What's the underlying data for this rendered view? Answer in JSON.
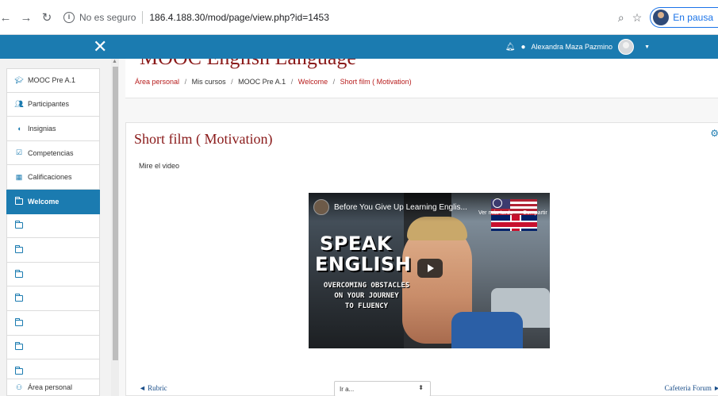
{
  "browser": {
    "back_icon": "arrow-left",
    "forward_icon": "arrow-right",
    "reload_icon": "reload",
    "security_text": "No es seguro",
    "url": "186.4.188.30/mod/page/view.php?id=1453",
    "profile_label": "En pausa"
  },
  "topbar": {
    "close_icon": "✕",
    "user_name": "Alexandra Maza Pazmino",
    "accent_color": "#1b7bb0"
  },
  "sidebar": {
    "items": [
      {
        "icon": "graduation-cap",
        "label": "MOOC Pre A.1",
        "active": false
      },
      {
        "icon": "users",
        "label": "Participantes",
        "active": false
      },
      {
        "icon": "shield",
        "label": "Insignias",
        "active": false
      },
      {
        "icon": "checkbox",
        "label": "Competencias",
        "active": false
      },
      {
        "icon": "table",
        "label": "Calificaciones",
        "active": false
      },
      {
        "icon": "folder",
        "label": "Welcome",
        "active": true
      },
      {
        "icon": "folder",
        "label": "",
        "active": false
      },
      {
        "icon": "folder",
        "label": "",
        "active": false
      },
      {
        "icon": "folder",
        "label": "",
        "active": false
      },
      {
        "icon": "folder",
        "label": "",
        "active": false
      },
      {
        "icon": "folder",
        "label": "",
        "active": false
      },
      {
        "icon": "folder",
        "label": "",
        "active": false
      },
      {
        "icon": "folder",
        "label": "",
        "active": false
      }
    ],
    "bottom_item": {
      "icon": "dashboard",
      "label": "Área personal"
    }
  },
  "header": {
    "course_title": "MOOC English Language",
    "breadcrumb": [
      {
        "label": "Área personal",
        "link": true
      },
      {
        "label": "Mis cursos",
        "link": false
      },
      {
        "label": "MOOC Pre A.1",
        "link": false
      },
      {
        "label": "Welcome",
        "link": true
      },
      {
        "label": "Short film ( Motivation)",
        "link": true
      }
    ]
  },
  "content": {
    "title": "Short film ( Motivation)",
    "intro": "Mire el video",
    "video": {
      "title": "Before You Give Up Learning Englis...",
      "watch_later": "Ver más tarde",
      "share": "Compartir",
      "headline_1": "SPEAK",
      "headline_2": "ENGLISH",
      "subtitle_1": "OVERCOMING OBSTACLES",
      "subtitle_2": "ON YOUR JOURNEY",
      "subtitle_3": "TO FLUENCY"
    },
    "prev_link": "◄ Rubric",
    "jump_placeholder": "Ir a...",
    "next_link": "Cafeteria Forum ►"
  }
}
